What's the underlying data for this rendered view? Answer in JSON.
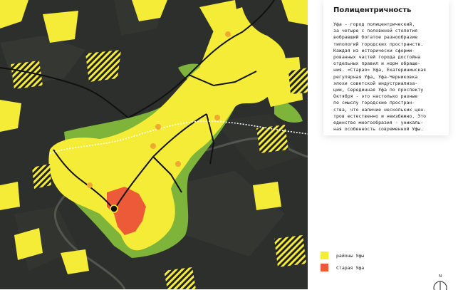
{
  "info_panel": {
    "title": "Полицентричность",
    "text": "Уфа - город полицентрический,\nза четыре с половиной столетия\nвобравший богатое разнообразие\nтипологий городских пространств.\nКаждая из исторически сформи-\nрованных частей города достойна\nотдельных правил и норм обраще-\nния. «Старая» Уфа, Екатерининская\nрегулярная Уфа, Уфа-Черниковка\nэпохи советской индустриализа-\nции, Серединная Уфа по проспекту\nОктября - это настолько разные\nпо смыслу городские простран-\nства, что наличие нескольких цен-\nтров естественно и неизбежно. Это\nединство многообразия - уникаль-\nная особенность современной Уфы."
  },
  "legend": [
    {
      "label": "районы Уфы",
      "color": "#f4ec36"
    },
    {
      "label": "Старая Уфа",
      "color": "#ec5a38"
    }
  ],
  "north_arrow": {
    "label": "N"
  },
  "colors": {
    "districts": "#f4ec36",
    "old_ufa": "#ec5a38",
    "green_zones": "#7fb43a",
    "centers": "#f0a830",
    "background": "#2d2f2c",
    "roads": "#111111"
  }
}
